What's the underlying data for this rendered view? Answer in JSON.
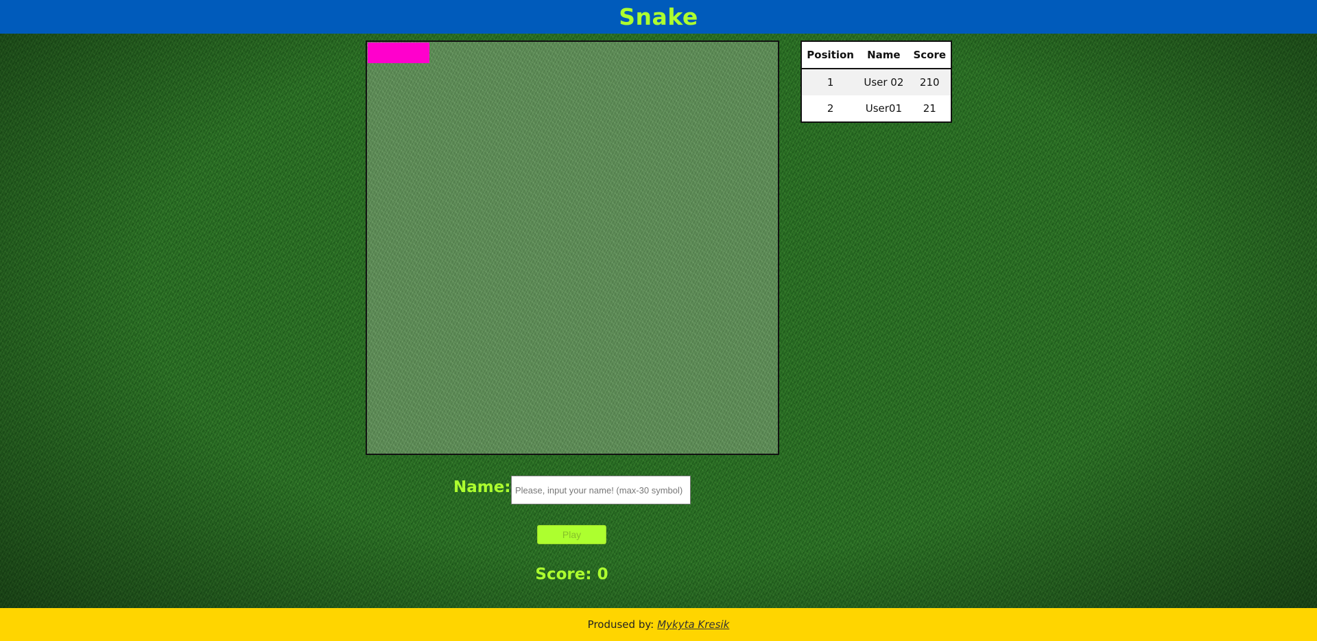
{
  "header": {
    "title": "Snake"
  },
  "game": {
    "snake_color": "#ff00cc",
    "board_bg": "#5c8a55"
  },
  "scoreboard": {
    "headers": [
      "Position",
      "Name",
      "Score"
    ],
    "rows": [
      {
        "position": "1",
        "name": "User 02",
        "score": "210"
      },
      {
        "position": "2",
        "name": "User01",
        "score": "21"
      }
    ]
  },
  "form": {
    "name_label": "Name:",
    "name_placeholder": "Please, input your name! (max-30 symbol)",
    "play_label": "Play"
  },
  "score": {
    "label": "Score: 0"
  },
  "footer": {
    "produced_label": "Prodused by:",
    "author": "Mykyta Kresik"
  },
  "colors": {
    "header_bg": "#005bbb",
    "footer_bg": "#ffd500",
    "accent": "#adff2f"
  }
}
